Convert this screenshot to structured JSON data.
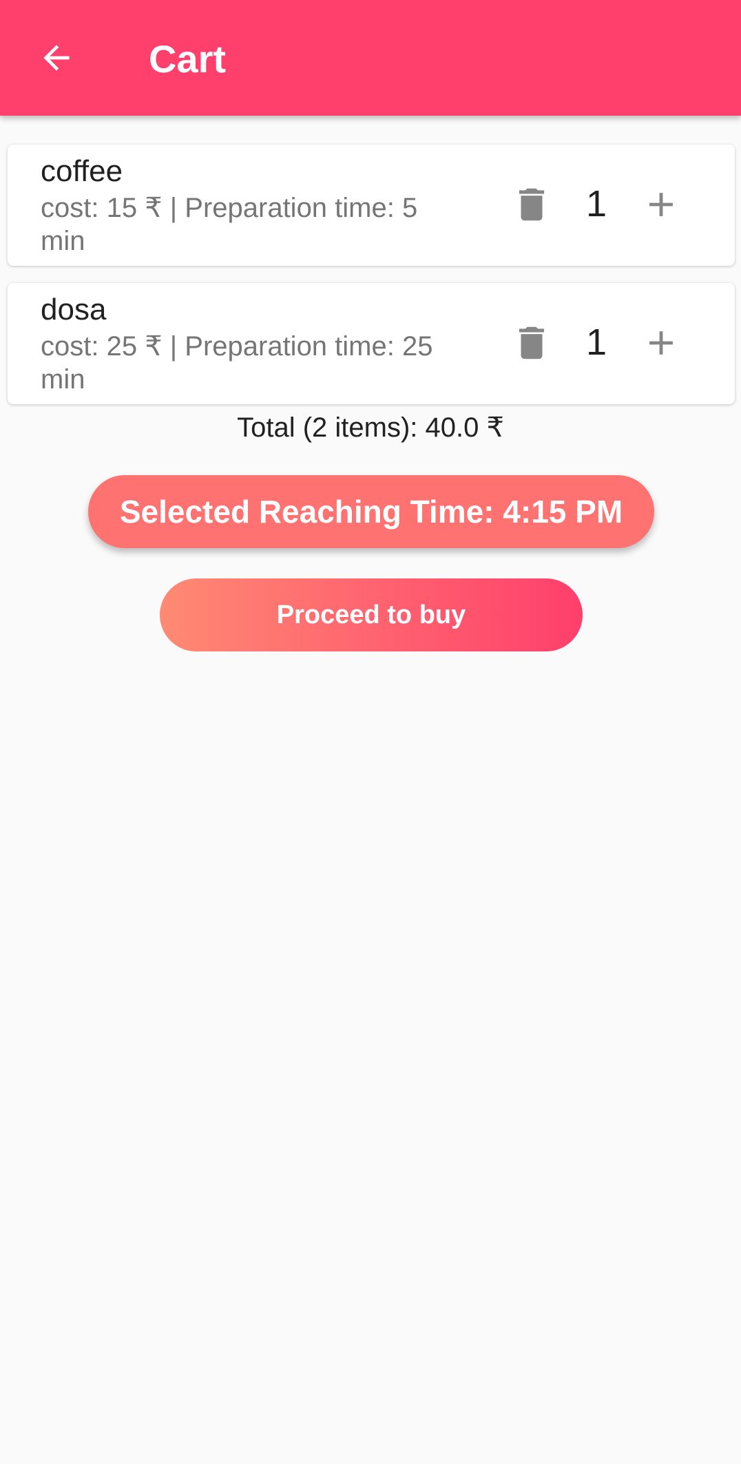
{
  "app_bar": {
    "title": "Cart",
    "back_icon": "arrow-back-icon",
    "color": "#ff3f6c"
  },
  "cart": {
    "items": [
      {
        "name": "coffee",
        "details": "cost: 15 ₹  |  Preparation time: 5 min",
        "quantity": "1",
        "delete_icon": "trash-icon",
        "add_icon": "plus-icon"
      },
      {
        "name": "dosa",
        "details": "cost: 25 ₹  |  Preparation time: 25 min",
        "quantity": "1",
        "delete_icon": "trash-icon",
        "add_icon": "plus-icon"
      }
    ],
    "total": "Total (2 items): 40.0 ₹"
  },
  "actions": {
    "reaching_time_label": "Selected Reaching Time: 4:15 PM",
    "proceed_label": "Proceed to buy"
  },
  "colors": {
    "accent": "#ff3f6c",
    "reach_button": "#ff7272",
    "gradient_start": "#ff8a73",
    "icon_grey": "#868686"
  }
}
